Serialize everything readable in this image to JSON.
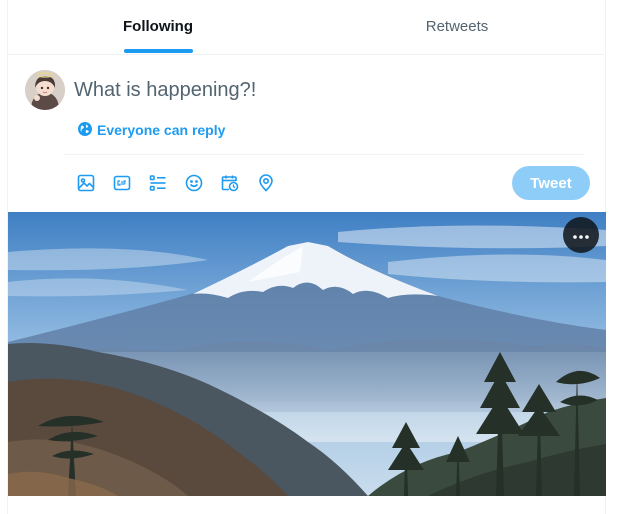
{
  "tabs": [
    {
      "label": "Following",
      "active": true
    },
    {
      "label": "Retweets",
      "active": false
    }
  ],
  "compose": {
    "placeholder": "What is happening?!",
    "value": ""
  },
  "reply_setting": {
    "label": "Everyone can reply",
    "icon": "globe-icon"
  },
  "toolbar": {
    "icons": [
      "image-icon",
      "gif-icon",
      "poll-icon",
      "emoji-icon",
      "schedule-icon",
      "location-icon"
    ],
    "tweet_label": "Tweet"
  },
  "media": {
    "image": "mountain-landscape-photo",
    "more_icon": "more-horizontal-icon"
  },
  "colors": {
    "accent": "#1d9bf0",
    "tweet_disabled": "#8ecdf8",
    "text": "#0f1419",
    "muted": "#536471",
    "border": "#eff3f4"
  }
}
